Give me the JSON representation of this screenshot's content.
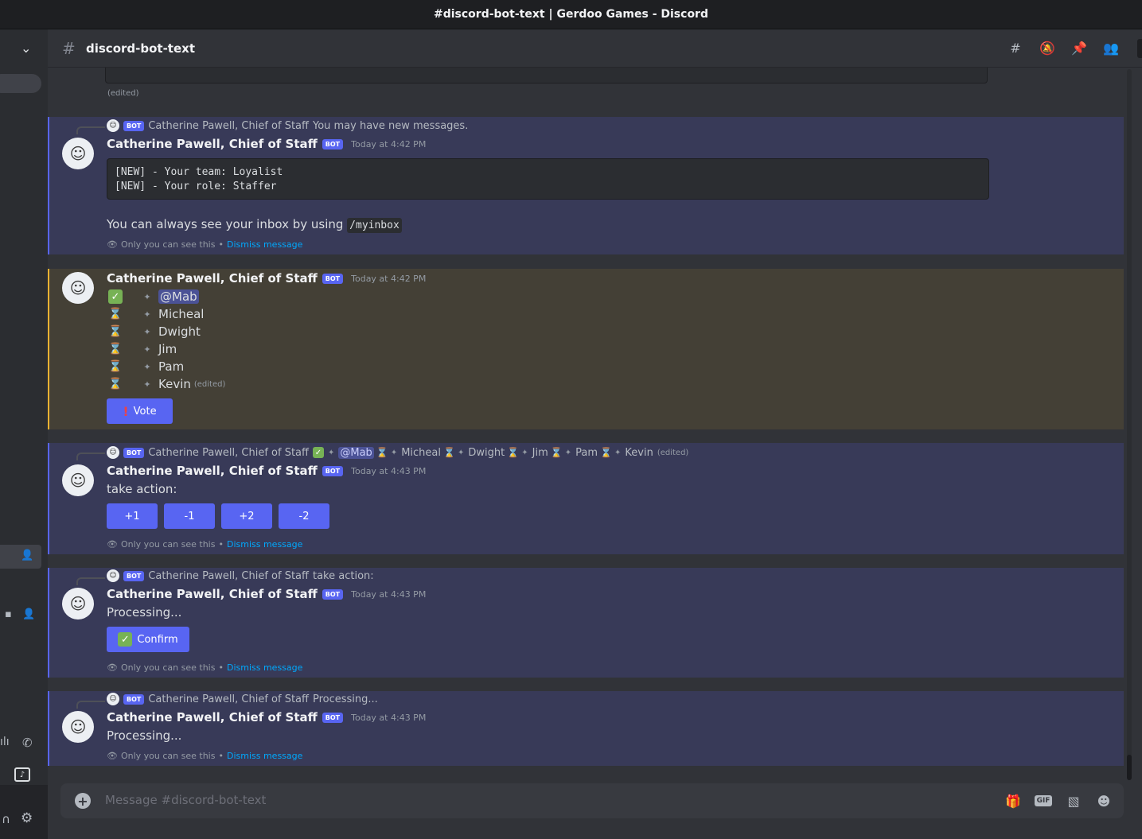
{
  "window_title": "#discord-bot-text | Gerdoo Games - Discord",
  "channel": {
    "name": "discord-bot-text",
    "placeholder": "Message #discord-bot-text"
  },
  "bot_tag": "BOT",
  "bot_name": "Catherine Pawell, Chief of Staff",
  "top_edited": "(edited)",
  "ephemeral": {
    "only_you": "Only you can see this",
    "separator": "•",
    "dismiss": "Dismiss message"
  },
  "msg1": {
    "reply_text": "You may have new messages.",
    "timestamp": "Today at 4:42 PM",
    "code_lines": "[NEW] - Your team: Loyalist\n[NEW] - Your role: Staffer",
    "text_before": "You can always see your inbox by using ",
    "code_inline": "/myinbox"
  },
  "msg2": {
    "timestamp": "Today at 4:42 PM",
    "voters": [
      {
        "name": "@Mab",
        "status": "voted",
        "mention": true
      },
      {
        "name": "Micheal",
        "status": "waiting"
      },
      {
        "name": "Dwight",
        "status": "waiting"
      },
      {
        "name": "Jim",
        "status": "waiting"
      },
      {
        "name": "Pam",
        "status": "waiting"
      },
      {
        "name": "Kevin",
        "status": "waiting",
        "edited": "(edited)"
      }
    ],
    "button": "Vote"
  },
  "msg3": {
    "reply_names": [
      "@Mab",
      "Micheal",
      "Dwight",
      "Jim",
      "Pam",
      "Kevin"
    ],
    "reply_edited": "(edited)",
    "timestamp": "Today at 4:43 PM",
    "text": "take action:",
    "buttons": [
      "+1",
      "-1",
      "+2",
      "-2"
    ]
  },
  "msg4": {
    "reply_text": "take action:",
    "timestamp": "Today at 4:43 PM",
    "text": "Processing...",
    "button": "Confirm"
  },
  "msg5": {
    "reply_text": "Processing...",
    "timestamp": "Today at 4:43 PM",
    "text": "Processing..."
  },
  "colors": {
    "blurple": "#5865f2",
    "mention_highlight": "#f0b232",
    "link": "#00a8fc"
  },
  "icons": [
    "chevron-down-icon",
    "hash-icon",
    "threads-icon",
    "mute-icon",
    "pin-icon",
    "members-icon",
    "eye-icon",
    "plus-icon",
    "gift-icon",
    "gif-icon",
    "sticker-icon",
    "emoji-icon",
    "gear-icon",
    "headphones-icon",
    "phone-icon",
    "add-friend-icon"
  ]
}
